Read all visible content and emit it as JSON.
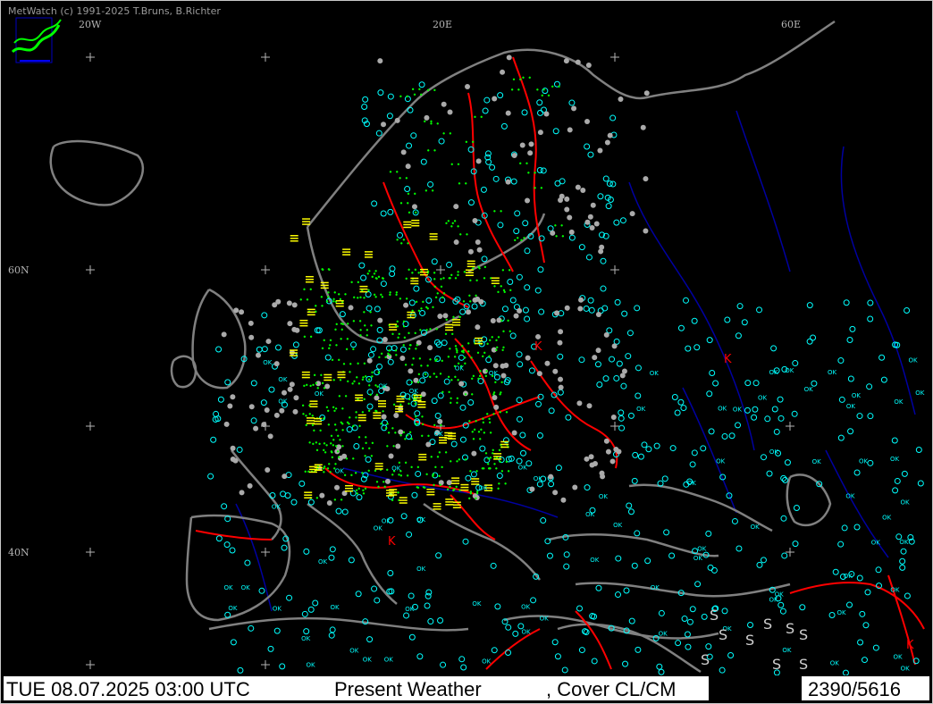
{
  "app": {
    "credit": "MetWatch  (c) 1991-2025 T.Bruns, B.Richter"
  },
  "map": {
    "region": "Europe",
    "grid_labels": {
      "lon_20w": "20W",
      "lon_20e": "20E",
      "lon_60e": "60E",
      "lat_60n": "60N",
      "lat_40n": "40N"
    },
    "colors": {
      "background": "#000000",
      "coastline": "#808080",
      "borders": "#ff0000",
      "rivers": "#0000a0",
      "clear_symbol": "#00ffff",
      "rain_symbol": "#00ff00",
      "fog_symbol": "#ffff00",
      "thunder_symbol": "#ff0000"
    },
    "symbols": {
      "ok": "OK",
      "dust": "S",
      "thunder": "K"
    }
  },
  "status": {
    "datetime": "TUE 08.07.2025 03:00 UTC",
    "parameter": "Present Weather",
    "cover": ", Cover CL/CM",
    "count": "2390/5616"
  }
}
